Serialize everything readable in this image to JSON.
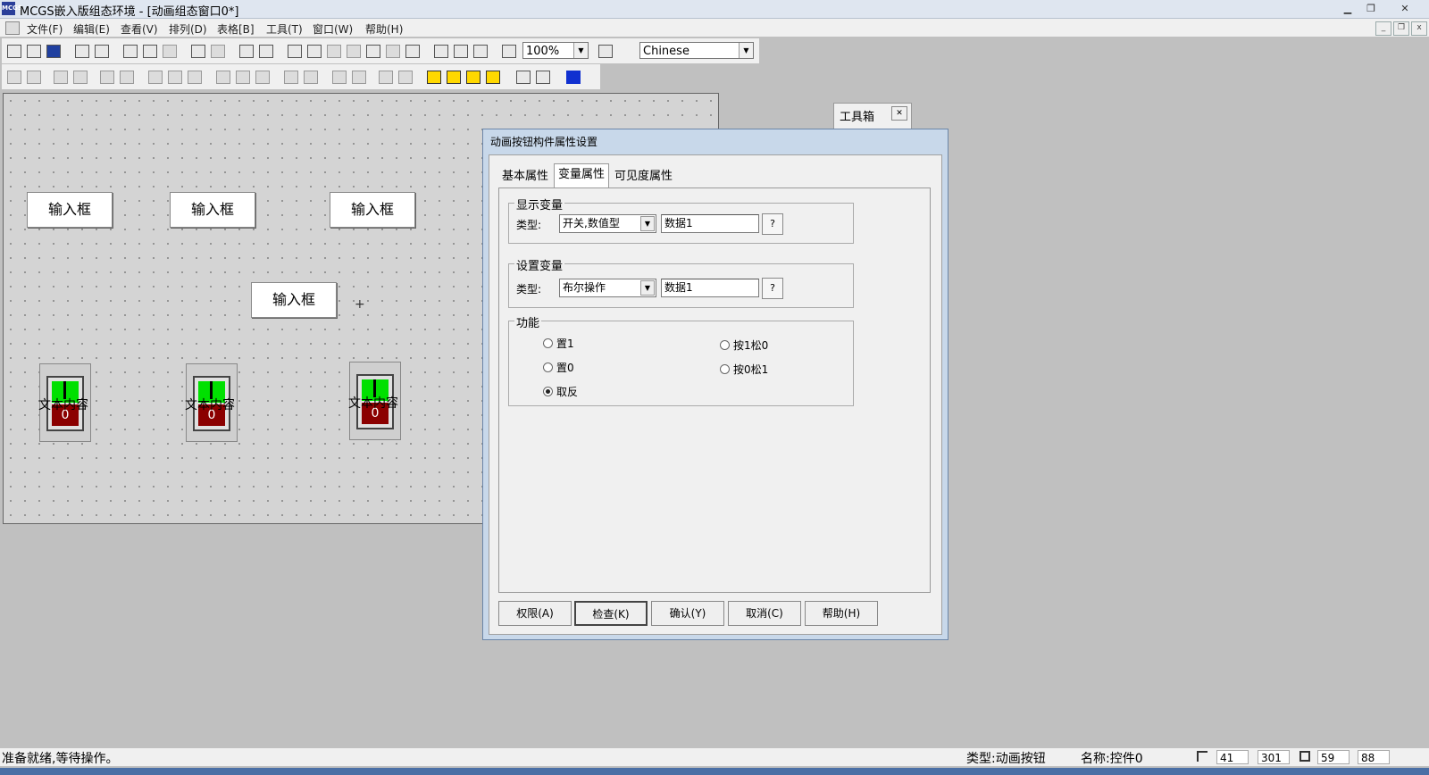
{
  "window": {
    "title": "MCGS嵌入版组态环境 - [动画组态窗口0*]",
    "app_icon": "mcgs-app-icon"
  },
  "menu": [
    "文件(F)",
    "编辑(E)",
    "查看(V)",
    "排列(D)",
    "表格[B]",
    "工具(T)",
    "窗口(W)",
    "帮助(H)"
  ],
  "toolbar": {
    "zoom": "100%",
    "language": "Chinese"
  },
  "canvas": {
    "input_boxes": [
      "输入框",
      "输入框",
      "输入框",
      "输入框"
    ],
    "switches": [
      {
        "label": "文本内容",
        "value": "0"
      },
      {
        "label": "文本内容",
        "value": "0"
      },
      {
        "label": "文本内容",
        "value": "0"
      }
    ],
    "cursor": "+"
  },
  "toolbox": {
    "title": "工具箱"
  },
  "dialog": {
    "title": "动画按钮构件属性设置",
    "tabs": [
      "基本属性",
      "变量属性",
      "可见度属性"
    ],
    "active_tab": "变量属性",
    "display_var": {
      "group": "显示变量",
      "type_label": "类型:",
      "type_value": "开关,数值型",
      "var_value": "数据1",
      "help": "?"
    },
    "set_var": {
      "group": "设置变量",
      "type_label": "类型:",
      "type_value": "布尔操作",
      "var_value": "数据1",
      "help": "?"
    },
    "function": {
      "group": "功能",
      "options": [
        "置1",
        "置0",
        "取反",
        "按1松0",
        "按0松1"
      ],
      "selected": "取反"
    },
    "buttons": [
      "权限(A)",
      "检查(K)",
      "确认(Y)",
      "取消(C)",
      "帮助(H)"
    ]
  },
  "status": {
    "message": "准备就绪,等待操作。",
    "type": "类型:动画按钮",
    "name": "名称:控件0",
    "x": "41",
    "y": "301",
    "w": "59",
    "h": "88"
  }
}
